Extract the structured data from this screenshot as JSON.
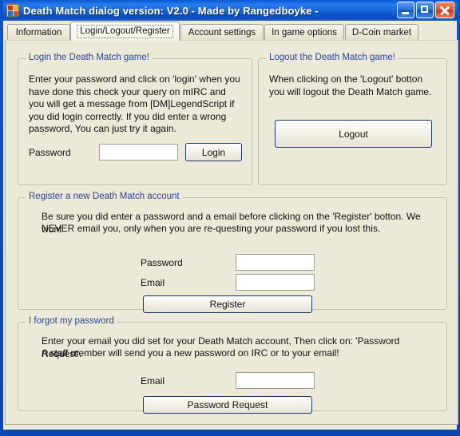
{
  "window": {
    "title": "Death Match dialog version: V2.0 - Made by Rangedboyke -",
    "icon": "app-icon",
    "controls": {
      "minimize": "minimize-button",
      "maximize": "maximize-button",
      "close": "close-button"
    },
    "accent_color": "#0a49b8",
    "client_background": "#ece9d8",
    "legend_color": "#27489b"
  },
  "tabs": [
    {
      "label": "Information",
      "active": false
    },
    {
      "label": "Login/Logout/Register",
      "active": true
    },
    {
      "label": "Account settings",
      "active": false
    },
    {
      "label": "In game options",
      "active": false
    },
    {
      "label": "D-Coin market",
      "active": false
    }
  ],
  "login_group": {
    "legend": "Login the Death Match game!",
    "description": "Enter your password and click on 'login' when you have done this check your query on mIRC and you will get a message from [DM]LegendScript if you did login correctly. If you did enter a wrong password, You can just try it again.",
    "password_label": "Password",
    "password_value": "",
    "login_button": "Login"
  },
  "logout_group": {
    "legend": "Logout the Death Match game!",
    "description": "When clicking on the 'Logout'  botton you will logout the Death Match game.",
    "logout_button": "Logout"
  },
  "register_group": {
    "legend": "Register a new Death Match account",
    "description_line1": "Be sure you did enter a password and a email before clicking on the 'Register' botton. We wont",
    "description_line2": "NEVER email you, only when you are re-questing your password if you lost this.",
    "password_label": "Password",
    "password_value": "",
    "email_label": "Email",
    "email_value": "",
    "register_button": "Register"
  },
  "forgot_group": {
    "legend": "I forgot my password",
    "description_line1": "Enter your email you did set for your Death Match account, Then click on: 'Password Request'.",
    "description_line2": "A staff member will send you a new password on IRC or to your email!",
    "email_label": "Email",
    "email_value": "",
    "request_button": "Password Request"
  }
}
